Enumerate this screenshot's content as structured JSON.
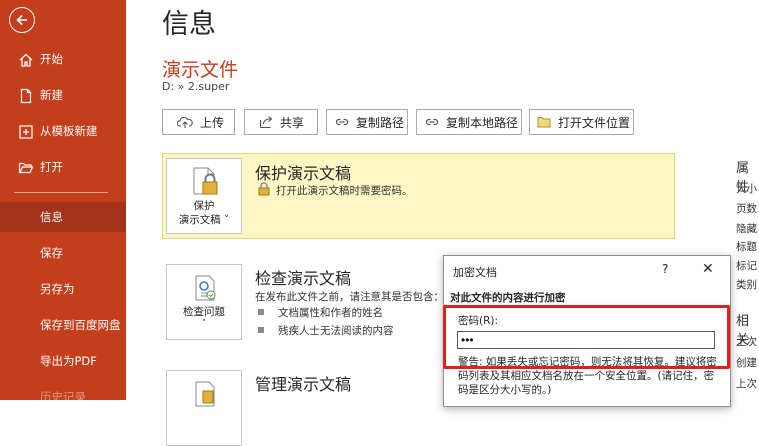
{
  "sidebar": {
    "items": [
      {
        "label": "开始"
      },
      {
        "label": "新建"
      },
      {
        "label": "从模板新建"
      },
      {
        "label": "打开"
      },
      {
        "label": "信息"
      },
      {
        "label": "保存"
      },
      {
        "label": "另存为"
      },
      {
        "label": "保存到百度网盘"
      },
      {
        "label": "导出为PDF"
      },
      {
        "label": "历史记录"
      }
    ]
  },
  "main": {
    "title": "信息",
    "doc_title": "演示文件",
    "path": "D: » 2.super",
    "toolbar": {
      "upload": "上传",
      "share": "共享",
      "copy_path": "复制路径",
      "copy_local_path": "复制本地路径",
      "open_location": "打开文件位置"
    },
    "protect": {
      "button_line1": "保护",
      "button_line2": "演示文稿",
      "title": "保护演示文稿",
      "desc": "打开此演示文稿时需要密码。"
    },
    "inspect": {
      "button_line1": "检查问题",
      "title": "检查演示文稿",
      "desc": "在发布此文件之前，请注意其是否包含：",
      "bullets": [
        "文档属性和作者的姓名",
        "残疾人士无法阅读的内容"
      ]
    },
    "manage": {
      "title": "管理演示文稿"
    }
  },
  "right_panel": {
    "heading1": "属性",
    "items": [
      "大小",
      "页数",
      "隐藏",
      "标题",
      "标记",
      "类别"
    ],
    "heading2": "相关",
    "items2": [
      "上次",
      "创建",
      "上次"
    ]
  },
  "dialog": {
    "title": "加密文档",
    "help": "?",
    "close": "✕",
    "header": "对此文件的内容进行加密",
    "password_label": "密码(R):",
    "password_value": "•••",
    "warning": "警告: 如果丢失或忘记密码，则无法将其恢复。建议将密码列表及其相应文档名放在一个安全位置。(请记住，密码是区分大小写的。)"
  }
}
